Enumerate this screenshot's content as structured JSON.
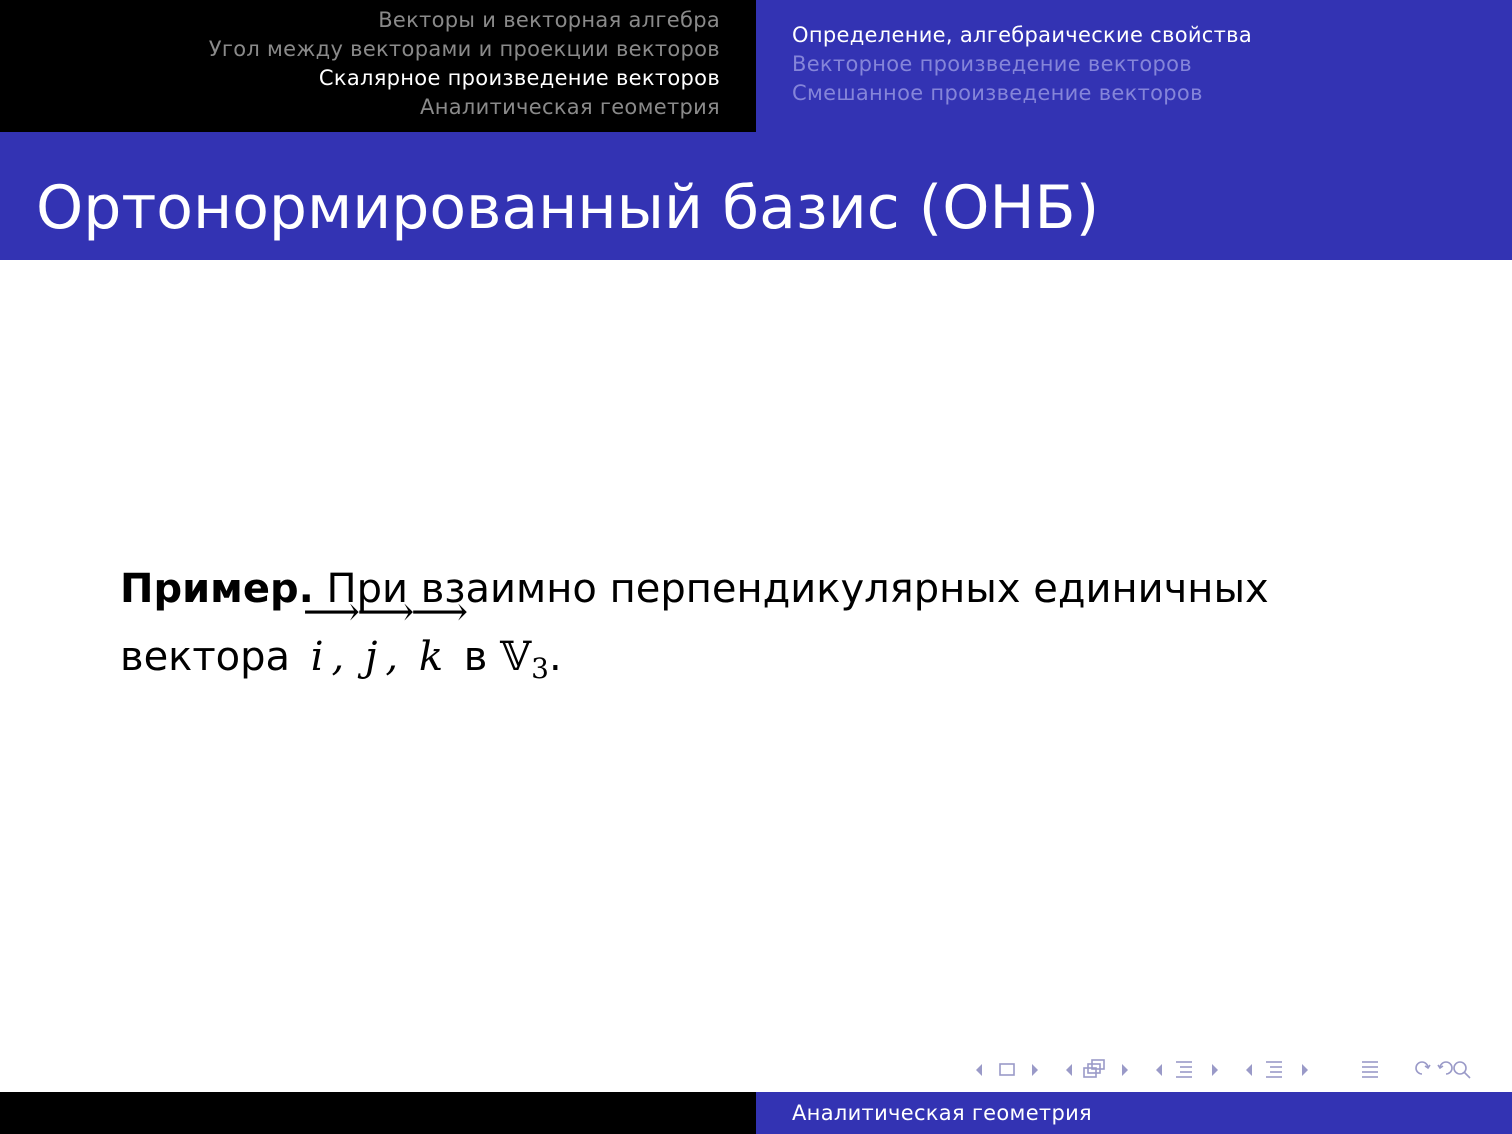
{
  "header": {
    "sections": [
      {
        "label": "Векторы и векторная алгебра",
        "active": false
      },
      {
        "label": "Угол между векторами и проекции векторов",
        "active": false
      },
      {
        "label": "Скалярное произведение векторов",
        "active": true
      },
      {
        "label": "Аналитическая геометрия",
        "active": false
      }
    ],
    "subsections": [
      {
        "label": "Определение, алгебраические свойства",
        "active": true
      },
      {
        "label": "Векторное произведение векторов",
        "active": false
      },
      {
        "label": "Смешанное произведение векторов",
        "active": false
      }
    ]
  },
  "frame": {
    "title": "Ортонормированный базис (ОНБ)"
  },
  "content": {
    "example_label": "Пример.",
    "line1_text": "При взаимно перпендикулярных единичных",
    "line2_text": "вектора",
    "vectors": [
      "i",
      "j",
      "k"
    ],
    "in_word": "в",
    "space_symbol": "𝕍",
    "space_dim": "3",
    "arrow_symbol": "⟶"
  },
  "navigation": {
    "color": "#9a9ac8",
    "icons": [
      "frame-nav-icon",
      "subsection-nav-icon",
      "section-nav-icon",
      "doc-nav-icon",
      "appendix-icon",
      "search-icon"
    ]
  },
  "footer": {
    "title": "Аналитическая геометрия"
  },
  "colors": {
    "beamer_blue": "#3333b3",
    "black": "#000000",
    "inactive_nav_left": "#8a8a8a",
    "inactive_nav_right": "#8585d9"
  }
}
